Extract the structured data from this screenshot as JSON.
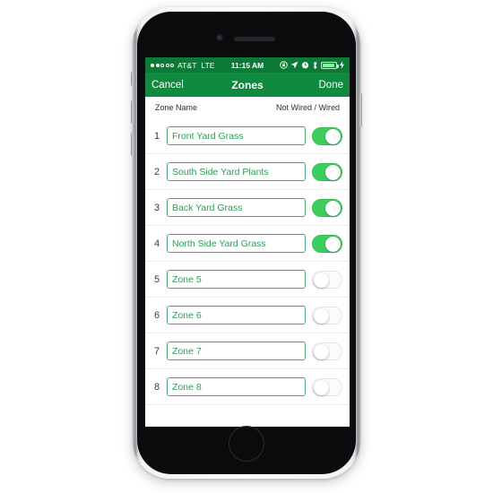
{
  "status_bar": {
    "signal_dots_filled": 2,
    "signal_dots_total": 5,
    "carrier": "AT&T",
    "network": "LTE",
    "time": "11:15 AM",
    "icons": [
      "rotation-lock-icon",
      "location-arrow-icon",
      "alarm-clock-icon",
      "bluetooth-icon"
    ],
    "battery_percent": 92,
    "charging": true,
    "background_color": "#0c7a36"
  },
  "nav_bar": {
    "cancel_label": "Cancel",
    "title": "Zones",
    "done_label": "Done",
    "background_color": "#0f8a3e"
  },
  "list_header": {
    "zone_name_label": "Zone Name",
    "wired_label": "Not Wired / Wired"
  },
  "theme": {
    "accent_green": "#0f8a3e",
    "toggle_on_green": "#3ece5f",
    "field_border_green": "#4aa86b",
    "field_text_green": "#2f9a57"
  },
  "zones": [
    {
      "index": "1",
      "name": "Front Yard Grass",
      "wired": true
    },
    {
      "index": "2",
      "name": "South Side Yard Plants",
      "wired": true
    },
    {
      "index": "3",
      "name": "Back Yard Grass",
      "wired": true
    },
    {
      "index": "4",
      "name": "North Side Yard Grass",
      "wired": true
    },
    {
      "index": "5",
      "name": "Zone 5",
      "wired": false
    },
    {
      "index": "6",
      "name": "Zone 6",
      "wired": false
    },
    {
      "index": "7",
      "name": "Zone 7",
      "wired": false
    },
    {
      "index": "8",
      "name": "Zone 8",
      "wired": false
    }
  ]
}
